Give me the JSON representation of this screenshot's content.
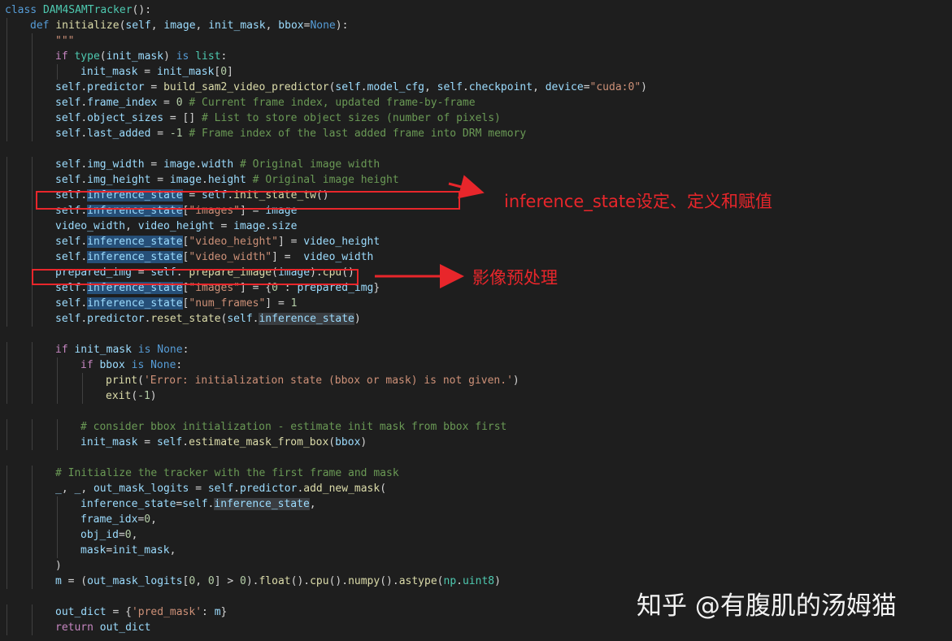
{
  "editor": {
    "theme_colors": {
      "background": "#1e1e1e",
      "default": "#d4d4d4",
      "keyword": "#569cd6",
      "control": "#c586c0",
      "function": "#dcdcaa",
      "class": "#4ec9b0",
      "variable": "#9cdcfe",
      "string": "#ce9178",
      "number": "#b5cea8",
      "comment": "#6a9955",
      "highlight": "#264f78",
      "annotation": "#e8262b"
    },
    "lines": [
      {
        "indent": 0,
        "tokens": [
          [
            "class ",
            "kw"
          ],
          [
            "DAM4SAMTracker",
            "cls"
          ],
          [
            "():",
            "d"
          ]
        ]
      },
      {
        "indent": 1,
        "tokens": [
          [
            "def ",
            "kw"
          ],
          [
            "initialize",
            "fn"
          ],
          [
            "(",
            "d"
          ],
          [
            "self",
            "var"
          ],
          [
            ", ",
            "d"
          ],
          [
            "image",
            "var"
          ],
          [
            ", ",
            "d"
          ],
          [
            "init_mask",
            "var"
          ],
          [
            ", ",
            "d"
          ],
          [
            "bbox",
            "var"
          ],
          [
            "=",
            "d"
          ],
          [
            "None",
            "kw"
          ],
          [
            "):",
            "d"
          ]
        ]
      },
      {
        "indent": 2,
        "tokens": [
          [
            "\"\"\"",
            "str"
          ]
        ]
      },
      {
        "indent": 2,
        "tokens": [
          [
            "if ",
            "ctl"
          ],
          [
            "type",
            "cls"
          ],
          [
            "(",
            "d"
          ],
          [
            "init_mask",
            "var"
          ],
          [
            ") ",
            "d"
          ],
          [
            "is ",
            "kw"
          ],
          [
            "list",
            "cls"
          ],
          [
            ":",
            "d"
          ]
        ]
      },
      {
        "indent": 3,
        "tokens": [
          [
            "init_mask",
            "var"
          ],
          [
            " = ",
            "d"
          ],
          [
            "init_mask",
            "var"
          ],
          [
            "[",
            "d"
          ],
          [
            "0",
            "num"
          ],
          [
            "]",
            "d"
          ]
        ]
      },
      {
        "indent": 2,
        "tokens": [
          [
            "self",
            "var"
          ],
          [
            ".",
            "d"
          ],
          [
            "predictor",
            "var"
          ],
          [
            " = ",
            "d"
          ],
          [
            "build_sam2_video_predictor",
            "fn"
          ],
          [
            "(",
            "d"
          ],
          [
            "self",
            "var"
          ],
          [
            ".",
            "d"
          ],
          [
            "model_cfg",
            "var"
          ],
          [
            ", ",
            "d"
          ],
          [
            "self",
            "var"
          ],
          [
            ".",
            "d"
          ],
          [
            "checkpoint",
            "var"
          ],
          [
            ", ",
            "d"
          ],
          [
            "device",
            "var"
          ],
          [
            "=",
            "d"
          ],
          [
            "\"cuda:0\"",
            "str"
          ],
          [
            ")",
            "d"
          ]
        ]
      },
      {
        "indent": 2,
        "tokens": [
          [
            "self",
            "var"
          ],
          [
            ".",
            "d"
          ],
          [
            "frame_index",
            "var"
          ],
          [
            " = ",
            "d"
          ],
          [
            "0",
            "num"
          ],
          [
            " # Current frame index, updated frame-by-frame",
            "cmt"
          ]
        ]
      },
      {
        "indent": 2,
        "tokens": [
          [
            "self",
            "var"
          ],
          [
            ".",
            "d"
          ],
          [
            "object_sizes",
            "var"
          ],
          [
            " = [] ",
            "d"
          ],
          [
            "# List to store object sizes (number of pixels)",
            "cmt"
          ]
        ]
      },
      {
        "indent": 2,
        "tokens": [
          [
            "self",
            "var"
          ],
          [
            ".",
            "d"
          ],
          [
            "last_added",
            "var"
          ],
          [
            " = ",
            "d"
          ],
          [
            "-1",
            "num"
          ],
          [
            " # Frame index of the last added frame into DRM memory",
            "cmt"
          ]
        ]
      },
      {
        "indent": 0,
        "tokens": []
      },
      {
        "indent": 2,
        "tokens": [
          [
            "self",
            "var"
          ],
          [
            ".",
            "d"
          ],
          [
            "img_width",
            "var"
          ],
          [
            " = ",
            "d"
          ],
          [
            "image",
            "var"
          ],
          [
            ".",
            "d"
          ],
          [
            "width",
            "var"
          ],
          [
            " # Original image width",
            "cmt"
          ]
        ]
      },
      {
        "indent": 2,
        "tokens": [
          [
            "self",
            "var"
          ],
          [
            ".",
            "d"
          ],
          [
            "img_height",
            "var"
          ],
          [
            " = ",
            "d"
          ],
          [
            "image",
            "var"
          ],
          [
            ".",
            "d"
          ],
          [
            "height",
            "var"
          ],
          [
            " # Original image height",
            "cmt"
          ]
        ]
      },
      {
        "indent": 2,
        "tokens": [
          [
            "self",
            "var"
          ],
          [
            ".",
            "d"
          ],
          [
            "inference_",
            "var_hl"
          ],
          [
            "state",
            "var_hl"
          ],
          [
            " = ",
            "d"
          ],
          [
            "self",
            "var"
          ],
          [
            ".",
            "d"
          ],
          [
            "init_state_tw",
            "fn"
          ],
          [
            "()",
            "d"
          ]
        ]
      },
      {
        "indent": 2,
        "tokens": [
          [
            "self",
            "var"
          ],
          [
            ".",
            "d"
          ],
          [
            "inference_state",
            "var_hl"
          ],
          [
            "[",
            "d"
          ],
          [
            "\"images\"",
            "str"
          ],
          [
            "] = ",
            "d"
          ],
          [
            "image",
            "var"
          ]
        ]
      },
      {
        "indent": 2,
        "tokens": [
          [
            "video_width",
            "var"
          ],
          [
            ", ",
            "d"
          ],
          [
            "video_height",
            "var"
          ],
          [
            " = ",
            "d"
          ],
          [
            "image",
            "var"
          ],
          [
            ".",
            "d"
          ],
          [
            "size",
            "var"
          ]
        ]
      },
      {
        "indent": 2,
        "tokens": [
          [
            "self",
            "var"
          ],
          [
            ".",
            "d"
          ],
          [
            "inference_state",
            "var_hl"
          ],
          [
            "[",
            "d"
          ],
          [
            "\"video_height\"",
            "str"
          ],
          [
            "] = ",
            "d"
          ],
          [
            "video_height",
            "var"
          ]
        ]
      },
      {
        "indent": 2,
        "tokens": [
          [
            "self",
            "var"
          ],
          [
            ".",
            "d"
          ],
          [
            "inference_state",
            "var_hl"
          ],
          [
            "[",
            "d"
          ],
          [
            "\"video_width\"",
            "str"
          ],
          [
            "] =  ",
            "d"
          ],
          [
            "video_width",
            "var"
          ]
        ]
      },
      {
        "indent": 2,
        "tokens": [
          [
            "prepared_img",
            "var"
          ],
          [
            " = ",
            "d"
          ],
          [
            "self",
            "var"
          ],
          [
            ". ",
            "d"
          ],
          [
            "prepare_image",
            "fn"
          ],
          [
            "(",
            "d"
          ],
          [
            "image",
            "var"
          ],
          [
            ").",
            "d"
          ],
          [
            "cpu",
            "fn"
          ],
          [
            "()",
            "d"
          ]
        ]
      },
      {
        "indent": 2,
        "tokens": [
          [
            "self",
            "var"
          ],
          [
            ".",
            "d"
          ],
          [
            "inference_state",
            "var_hl"
          ],
          [
            "[",
            "d"
          ],
          [
            "\"images\"",
            "str"
          ],
          [
            "] = {",
            "d"
          ],
          [
            "0",
            "num"
          ],
          [
            " : ",
            "d"
          ],
          [
            "prepared_img",
            "var"
          ],
          [
            "}",
            "d"
          ]
        ]
      },
      {
        "indent": 2,
        "tokens": [
          [
            "self",
            "var"
          ],
          [
            ".",
            "d"
          ],
          [
            "inference_state",
            "var_hl"
          ],
          [
            "[",
            "d"
          ],
          [
            "\"num_frames\"",
            "str"
          ],
          [
            "] = ",
            "d"
          ],
          [
            "1",
            "num"
          ]
        ]
      },
      {
        "indent": 2,
        "tokens": [
          [
            "self",
            "var"
          ],
          [
            ".",
            "d"
          ],
          [
            "predictor",
            "var"
          ],
          [
            ".",
            "d"
          ],
          [
            "reset_state",
            "fn"
          ],
          [
            "(",
            "d"
          ],
          [
            "self",
            "var"
          ],
          [
            ".",
            "d"
          ],
          [
            "inference_state",
            "var_hl2"
          ],
          [
            ")",
            "d"
          ]
        ]
      },
      {
        "indent": 0,
        "tokens": []
      },
      {
        "indent": 2,
        "tokens": [
          [
            "if ",
            "ctl"
          ],
          [
            "init_mask",
            "var"
          ],
          [
            " ",
            "d"
          ],
          [
            "is ",
            "kw"
          ],
          [
            "None",
            "kw"
          ],
          [
            ":",
            "d"
          ]
        ]
      },
      {
        "indent": 3,
        "tokens": [
          [
            "if ",
            "ctl"
          ],
          [
            "bbox",
            "var"
          ],
          [
            " ",
            "d"
          ],
          [
            "is ",
            "kw"
          ],
          [
            "None",
            "kw"
          ],
          [
            ":",
            "d"
          ]
        ]
      },
      {
        "indent": 4,
        "tokens": [
          [
            "print",
            "fn"
          ],
          [
            "(",
            "d"
          ],
          [
            "'Error: initialization state (bbox or mask) is not given.'",
            "str"
          ],
          [
            ")",
            "d"
          ]
        ]
      },
      {
        "indent": 4,
        "tokens": [
          [
            "exit",
            "fn"
          ],
          [
            "(",
            "d"
          ],
          [
            "-1",
            "num"
          ],
          [
            ")",
            "d"
          ]
        ]
      },
      {
        "indent": 0,
        "tokens": []
      },
      {
        "indent": 3,
        "tokens": [
          [
            "# consider bbox initialization - estimate init mask from bbox first",
            "cmt"
          ]
        ]
      },
      {
        "indent": 3,
        "tokens": [
          [
            "init_mask",
            "var"
          ],
          [
            " = ",
            "d"
          ],
          [
            "self",
            "var"
          ],
          [
            ".",
            "d"
          ],
          [
            "estimate_mask_from_box",
            "fn"
          ],
          [
            "(",
            "d"
          ],
          [
            "bbox",
            "var"
          ],
          [
            ")",
            "d"
          ]
        ]
      },
      {
        "indent": 0,
        "tokens": []
      },
      {
        "indent": 2,
        "tokens": [
          [
            "# Initialize the tracker with the first frame and mask",
            "cmt"
          ]
        ]
      },
      {
        "indent": 2,
        "tokens": [
          [
            "_",
            "var"
          ],
          [
            ", ",
            "d"
          ],
          [
            "_",
            "var"
          ],
          [
            ", ",
            "d"
          ],
          [
            "out_mask_logits",
            "var"
          ],
          [
            " = ",
            "d"
          ],
          [
            "self",
            "var"
          ],
          [
            ".",
            "d"
          ],
          [
            "predictor",
            "var"
          ],
          [
            ".",
            "d"
          ],
          [
            "add_new_mask",
            "fn"
          ],
          [
            "(",
            "d"
          ]
        ]
      },
      {
        "indent": 3,
        "tokens": [
          [
            "inference_state",
            "var"
          ],
          [
            "=",
            "d"
          ],
          [
            "self",
            "var"
          ],
          [
            ".",
            "d"
          ],
          [
            "inference_state",
            "var_hl2"
          ],
          [
            ",",
            "d"
          ]
        ]
      },
      {
        "indent": 3,
        "tokens": [
          [
            "frame_idx",
            "var"
          ],
          [
            "=",
            "d"
          ],
          [
            "0",
            "num"
          ],
          [
            ",",
            "d"
          ]
        ]
      },
      {
        "indent": 3,
        "tokens": [
          [
            "obj_id",
            "var"
          ],
          [
            "=",
            "d"
          ],
          [
            "0",
            "num"
          ],
          [
            ",",
            "d"
          ]
        ]
      },
      {
        "indent": 3,
        "tokens": [
          [
            "mask",
            "var"
          ],
          [
            "=",
            "d"
          ],
          [
            "init_mask",
            "var"
          ],
          [
            ",",
            "d"
          ]
        ]
      },
      {
        "indent": 2,
        "tokens": [
          [
            ")",
            "d"
          ]
        ]
      },
      {
        "indent": 2,
        "tokens": [
          [
            "m",
            "var"
          ],
          [
            " = (",
            "d"
          ],
          [
            "out_mask_logits",
            "var"
          ],
          [
            "[",
            "d"
          ],
          [
            "0",
            "num"
          ],
          [
            ", ",
            "d"
          ],
          [
            "0",
            "num"
          ],
          [
            "] > ",
            "d"
          ],
          [
            "0",
            "num"
          ],
          [
            ").",
            "d"
          ],
          [
            "float",
            "fn"
          ],
          [
            "().",
            "d"
          ],
          [
            "cpu",
            "fn"
          ],
          [
            "().",
            "d"
          ],
          [
            "numpy",
            "fn"
          ],
          [
            "().",
            "d"
          ],
          [
            "astype",
            "fn"
          ],
          [
            "(",
            "d"
          ],
          [
            "np",
            "cls"
          ],
          [
            ".",
            "d"
          ],
          [
            "uint8",
            "cls"
          ],
          [
            ")",
            "d"
          ]
        ]
      },
      {
        "indent": 0,
        "tokens": []
      },
      {
        "indent": 2,
        "tokens": [
          [
            "out_dict",
            "var"
          ],
          [
            " = {",
            "d"
          ],
          [
            "'pred_mask'",
            "str"
          ],
          [
            ": ",
            "d"
          ],
          [
            "m",
            "var"
          ],
          [
            "}",
            "d"
          ]
        ]
      },
      {
        "indent": 2,
        "tokens": [
          [
            "return ",
            "ctl"
          ],
          [
            "out_dict",
            "var"
          ]
        ]
      }
    ]
  },
  "annotations": {
    "label_1": "inference_state设定、定义和赋值",
    "label_2": "影像预处理"
  },
  "watermark": {
    "text": "知乎 @有腹肌的汤姆猫"
  }
}
